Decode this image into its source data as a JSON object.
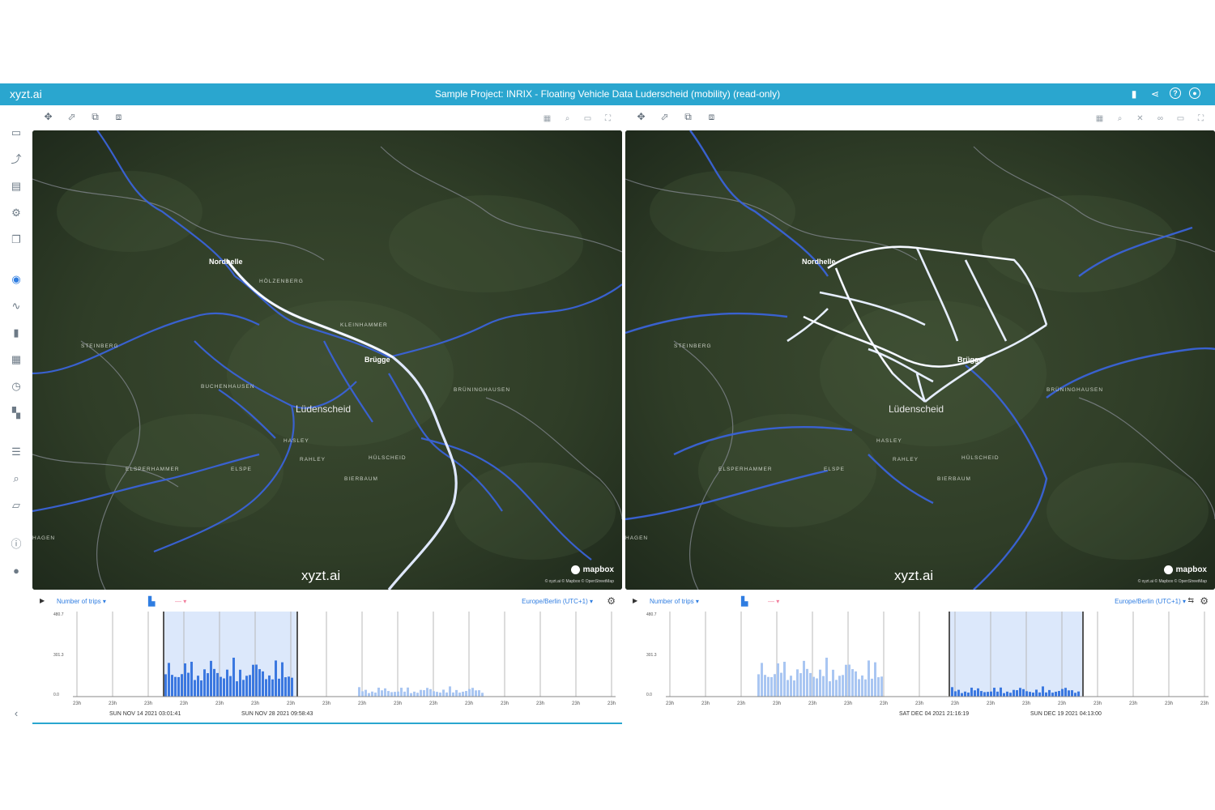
{
  "app": {
    "brand": "xyzt.ai",
    "title": "Sample Project: INRIX - Floating Vehicle Data Luderscheid (mobility) (read-only)",
    "topbar_icons": [
      "bookmark-icon",
      "share-icon",
      "help-icon",
      "account-icon"
    ]
  },
  "sidebar": {
    "items": [
      {
        "name": "folder-icon",
        "glyph": "▭"
      },
      {
        "name": "route-icon",
        "glyph": "⤴"
      },
      {
        "name": "layers-icon",
        "glyph": "▤"
      },
      {
        "name": "settings-icon",
        "glyph": "⚙"
      },
      {
        "name": "copy-icon",
        "glyph": "❐"
      },
      {
        "name": "globe-icon",
        "glyph": "◉",
        "active": true
      },
      {
        "name": "line-chart-icon",
        "glyph": "∿"
      },
      {
        "name": "bar-chart-icon",
        "glyph": "▮"
      },
      {
        "name": "grid-icon",
        "glyph": "▦"
      },
      {
        "name": "clock-icon",
        "glyph": "◷"
      },
      {
        "name": "dashboard-icon",
        "glyph": "▚"
      },
      {
        "name": "table-icon",
        "glyph": "☰"
      },
      {
        "name": "search-icon",
        "glyph": "⌕"
      },
      {
        "name": "map-icon",
        "glyph": "▱"
      },
      {
        "name": "info-icon",
        "glyph": "ⓘ"
      },
      {
        "name": "bulb-icon",
        "glyph": "●"
      },
      {
        "name": "collapse-icon",
        "glyph": "‹"
      }
    ]
  },
  "panels": [
    {
      "id": "left",
      "watermark": "xyzt.ai",
      "mapbox_label": "mapbox",
      "attribution": "© xyzt.ai © Mapbox © OpenStreetMap",
      "histogram": {
        "metric": "Number of trips",
        "timezone": "Europe/Berlin (UTC+1)",
        "y_ticks": [
          "480.7",
          "301.3",
          "0.0"
        ],
        "x_ticks": [
          "23h",
          "23h",
          "23h",
          "23h",
          "23h",
          "23h",
          "23h",
          "23h",
          "23h",
          "23h",
          "23h",
          "23h",
          "23h",
          "23h",
          "23h",
          "23h"
        ],
        "selection_start": "SUN NOV 14 2021 03:01:41",
        "selection_end": "SUN NOV 28 2021 09:58:43"
      }
    },
    {
      "id": "right",
      "watermark": "xyzt.ai",
      "mapbox_label": "mapbox",
      "attribution": "© xyzt.ai © Mapbox © OpenStreetMap",
      "histogram": {
        "metric": "Number of trips",
        "timezone": "Europe/Berlin (UTC+1)",
        "y_ticks": [
          "480.7",
          "301.3",
          "0.0"
        ],
        "x_ticks": [
          "23h",
          "23h",
          "23h",
          "23h",
          "23h",
          "23h",
          "23h",
          "23h",
          "23h",
          "23h",
          "23h",
          "23h",
          "23h",
          "23h",
          "23h",
          "23h"
        ],
        "selection_start": "SAT DEC 04 2021 21:16:19",
        "selection_end": "SUN DEC 19 2021 04:13:00"
      }
    }
  ],
  "map_labels": [
    "Nordhelle",
    "Lüdenscheid",
    "Brügge",
    "HASLEY",
    "RAHLEY",
    "ELSPE",
    "BUCHENHAUSEN",
    "BIERBAUM",
    "HÜLSCHEID",
    "BRÜNINGHAUSEN"
  ]
}
